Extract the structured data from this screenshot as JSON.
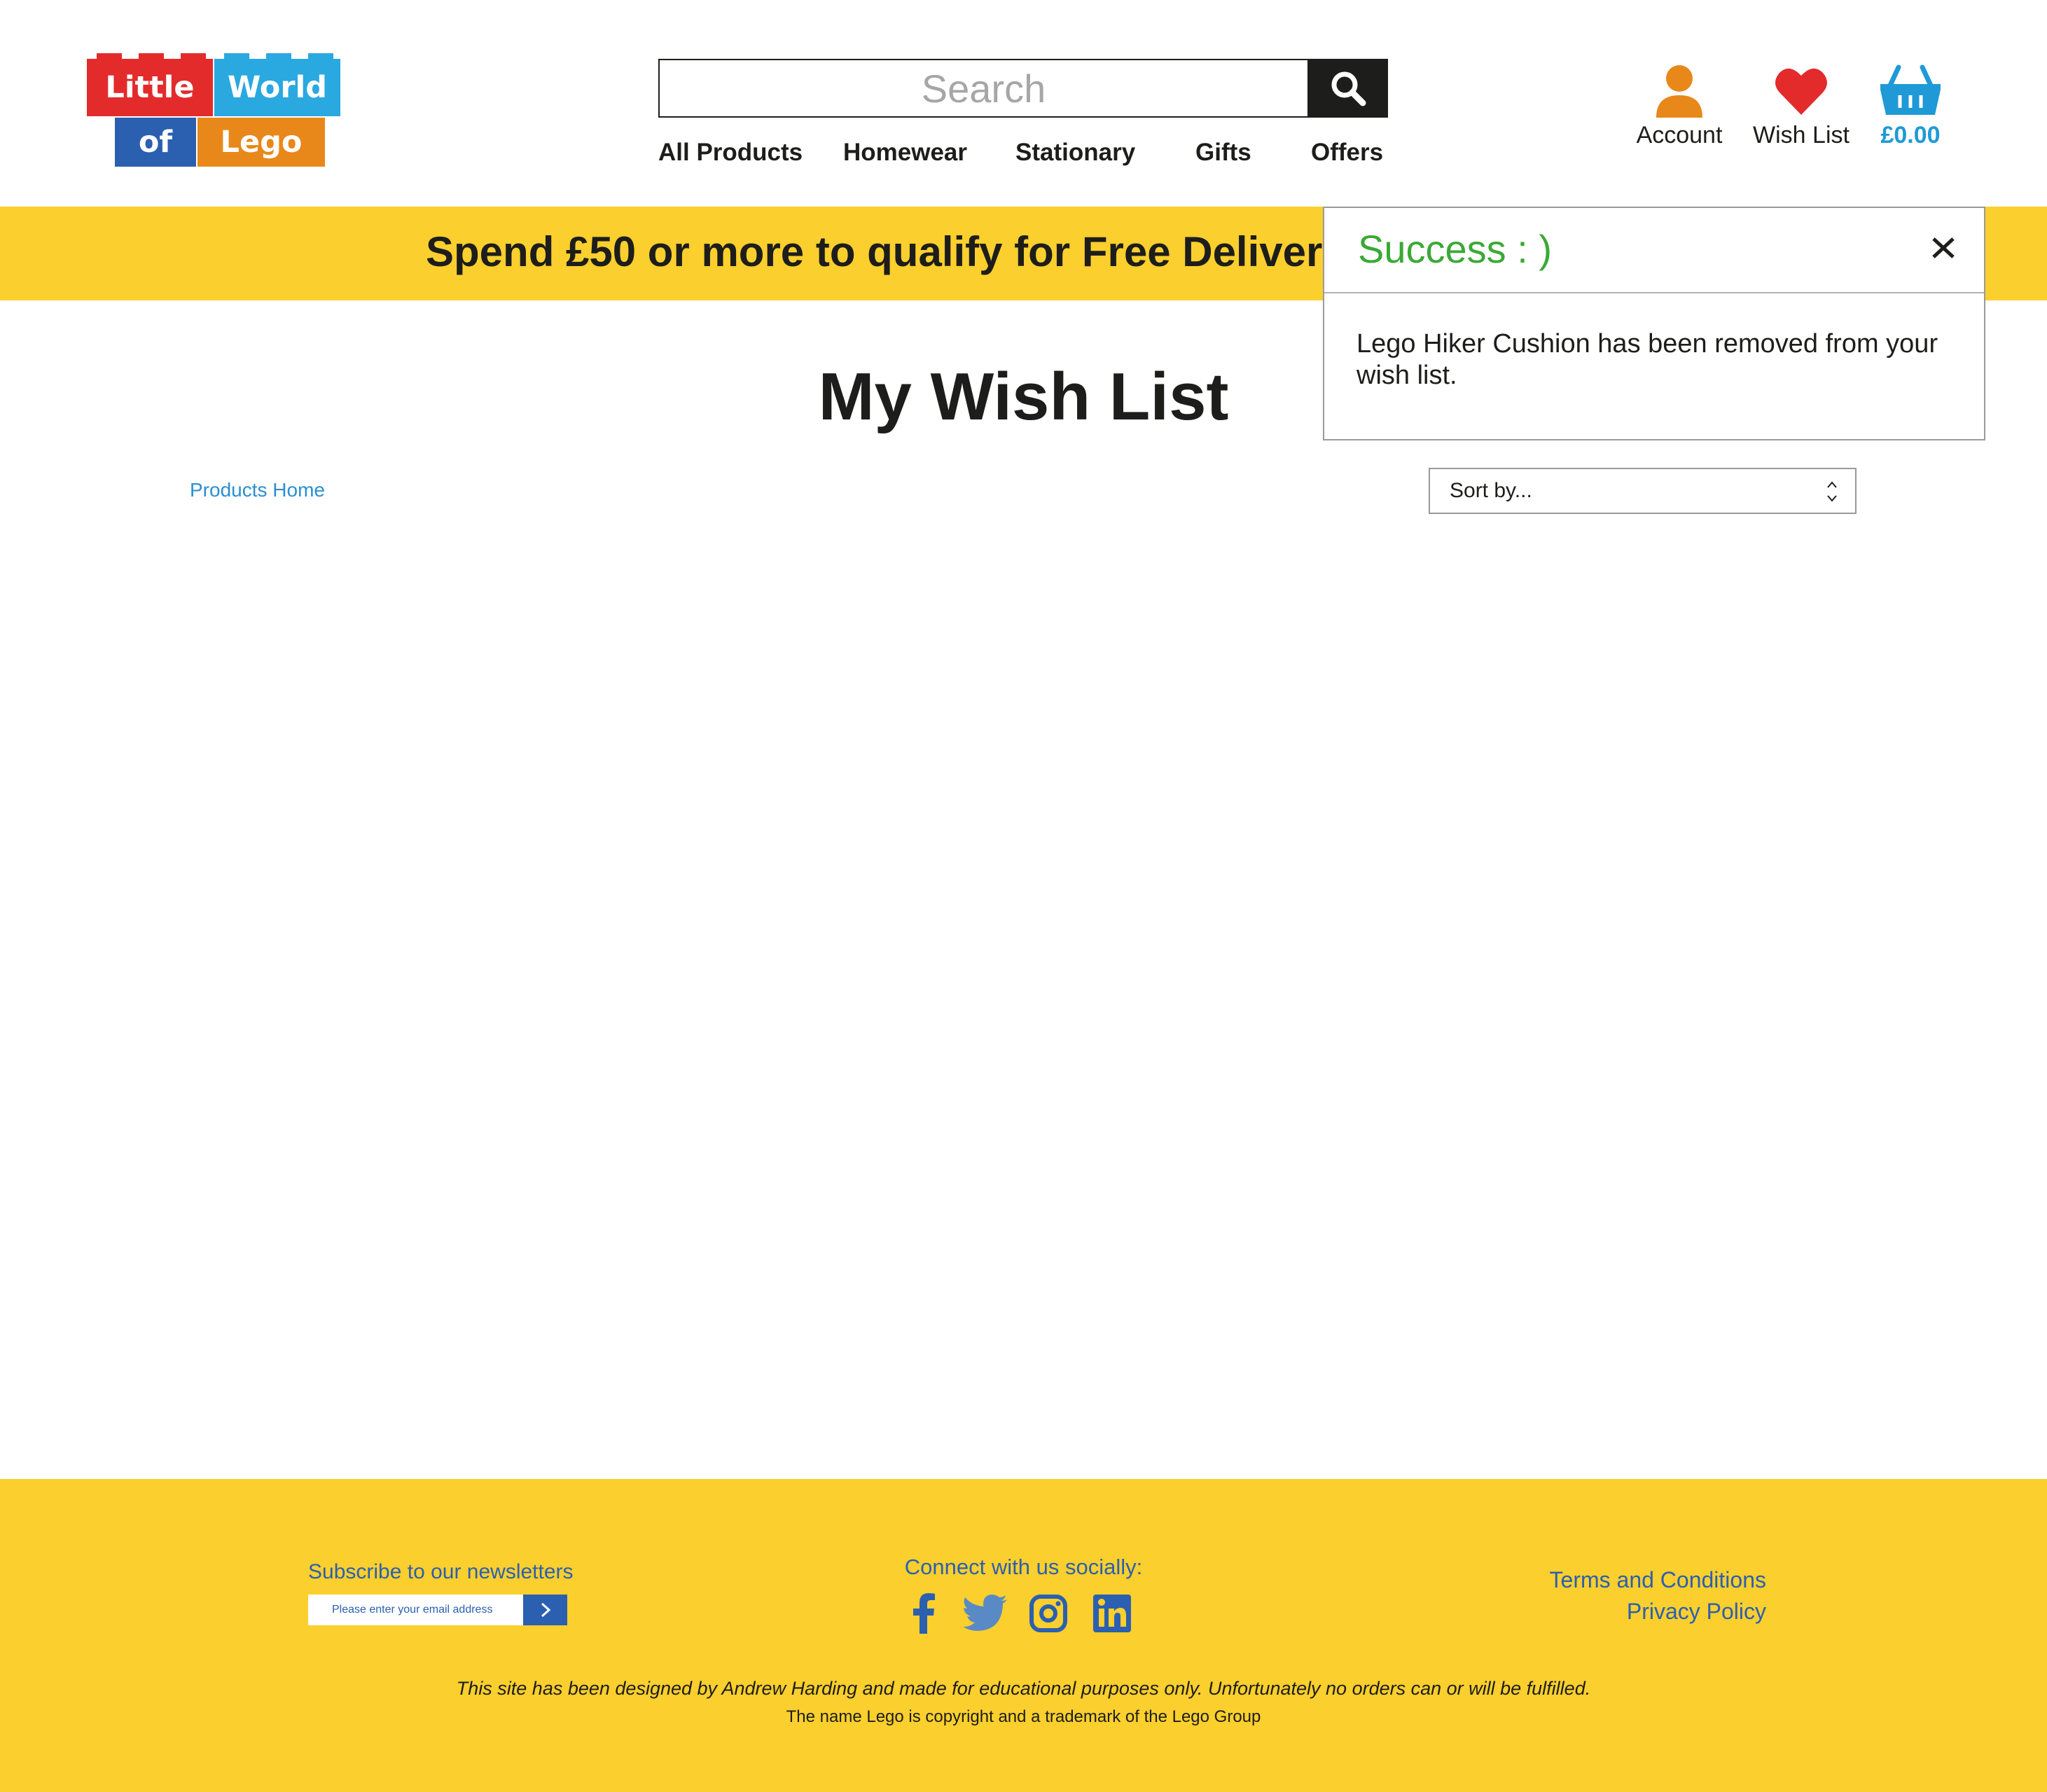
{
  "logo": {
    "words": [
      "Little",
      "World",
      "of",
      "Lego"
    ]
  },
  "search": {
    "placeholder": "Search"
  },
  "nav": {
    "items": [
      "All Products",
      "Homewear",
      "Stationary",
      "Gifts",
      "Offers"
    ]
  },
  "header": {
    "account_label": "Account",
    "wishlist_label": "Wish List",
    "basket_total": "£0.00"
  },
  "banner": {
    "text": "Spend £50 or more to qualify for Free Delivery"
  },
  "main": {
    "title": "My Wish List",
    "breadcrumb": "Products Home",
    "sort_placeholder": "Sort by..."
  },
  "toast": {
    "title": "Success : )",
    "message": "Lego Hiker Cushion has been removed from your wish list."
  },
  "footer": {
    "subscribe_title": "Subscribe to our newsletters",
    "subscribe_placeholder": "Please enter your email address",
    "social_title": "Connect with us socially:",
    "social": [
      "facebook-icon",
      "twitter-icon",
      "instagram-icon",
      "linkedin-icon"
    ],
    "terms": "Terms and Conditions",
    "privacy": "Privacy Policy",
    "disclaimer": "This site has been designed by Andrew Harding and made for educational purposes only. Unfortunately no orders can or will be fulfilled.",
    "copyright": "The name Lego is copyright and a trademark of the Lego Group"
  },
  "colors": {
    "yellow": "#fbcf2d",
    "dark": "#1d1d1b",
    "brand_blue": "#2b5fb0",
    "link_blue": "#1f9ad6",
    "success_green": "#3aa935",
    "heart_red": "#e32b2b",
    "account_orange": "#e8881a"
  }
}
